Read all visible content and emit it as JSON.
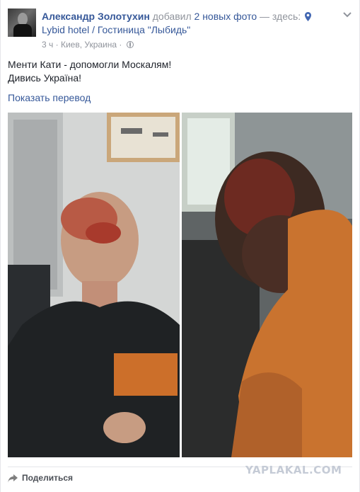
{
  "post": {
    "author": "Александр Золотухин",
    "action": "добавил",
    "photos_link": "2 новых фото",
    "location_prefix": "— здесь:",
    "location": "Lybid hotel / Гостиница \"Лыбидь\"",
    "time": "3 ч",
    "place": "Киев, Украина",
    "text_line1": "Менти Кати - допомогли Москалям!",
    "text_line2": "Дивись Україна!",
    "translate": "Показать перевод"
  },
  "actions": {
    "share": "Поделиться"
  },
  "watermark": "YAPLAKAL.COM",
  "colors": {
    "link": "#365899",
    "muted": "#90949c",
    "text": "#1d2129"
  }
}
